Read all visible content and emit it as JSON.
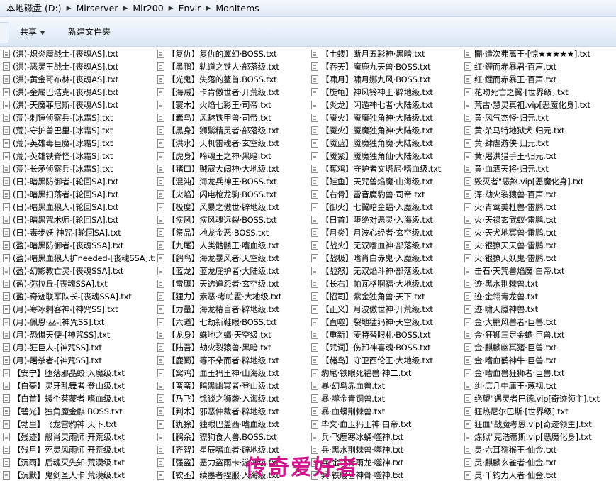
{
  "address": {
    "segments": [
      "本地磁盘 (D:)",
      "Mirserver",
      "Mir200",
      "Envir",
      "MonItems"
    ]
  },
  "toolbar": {
    "share_label": "共享",
    "new_folder_label": "新建文件夹"
  },
  "columns": [
    [
      "(洪)-炽炎魔战士-[丧魂AS].txt",
      "(洪)-恶灵王战士-[丧魂AS].txt",
      "(洪)-黄金哥布林-[丧魂AS].txt",
      "(洪)-金属巴浩克-[丧魂AS].txt",
      "(洪)-天魔菲尼斯-[丧魂AS].txt",
      "(荒)-刺锤侦察兵-[冰霜S].txt",
      "(荒)-守护兽巴里-[冰霜S].txt",
      "(荒)-英雄毒巨魔-[冰霜S].txt",
      "(荒)-英雄铁脊怪-[冰霜S].txt",
      "(荒)-长矛侦察兵-[冰霜S].txt",
      "(日)-暗黑防御者-[轮回SA].txt",
      "(日)-暗黑扫荡者-[轮回SA].txt",
      "(日)-暗黑血狼人-[轮回SA].txt",
      "(日)-暗黑咒术师-[轮回SA].txt",
      "(日)-毒步妖·神咒-[轮回SA].txt",
      "(盈)-暗黑防御者-[丧魂SSA].txt",
      "(盈)-暗黑血狼人扩needed-[丧魂SSA].txt",
      "(盈)-幻影教亡灵-[丧魂SSA].txt",
      "(盈)-弥拉丘-[丧魂SSA].txt",
      "(盈)-奇迹联军队长-[丧魂SSA].txt",
      "(月)-寒冰刺客神-[神咒SS].txt",
      "(月)-佩恩·巫-[神咒SS].txt",
      "(月)-恐惧天使-[神咒SS].txt",
      "(月)-狂巨人-[神咒SS].txt",
      "(月)-屠杀者-[神咒SS].txt",
      "【安宁】堕落邪晶蛟·入魔级.txt",
      "【白豪】灵牙乱舞者·登山级.txt",
      "【白首】矮个莱蒙者·嗜血级.txt",
      "【碧光】独角魔金麒·BOSS.txt",
      "【勃皇】飞龙雷豹神·天下.txt",
      "【残迹】般肖灵雨师·开荒级.txt",
      "【残月】死灵风雨师·开荒级.txt",
      "【沉雨】后魂灭先知·荒漠级.txt",
      "【沉默】鬼剑圣人卡·荒漠级.txt"
    ],
    [
      "【复仇】复仇的翼幻·BOSS.txt",
      "【黑鹏】轨道之铁人·部落级.txt",
      "【光鬼】失落的鳌首.BOSS.txt",
      "【海贼】卡肯傲世者·开荒级.txt",
      "【寰木】火焰七彩王·司帝.txt",
      "【蠹鸟】风魅铁甲兽·司帝.txt",
      "【黑身】狮鬃精灵者·部落级.txt",
      "【洪水】天机雷魂者·玄空级.txt",
      "【虎身】啼魂王之神·黑暗.txt",
      "【猪口】贼寇大阔神·大地级.txt",
      "【混沌】海龙兵神王·BOSS.txt",
      "【火焰】闪电枪龙驹·BOSS.txt",
      "【极度】风暴之傲世·辟地级.txt",
      "【疾风】疾风魂远裂·BOSS.txt",
      "【祭品】地龙金恶·BOSS.txt",
      "【九尾】人类骷髅王·嗜血级.txt",
      "【鹞鸟】海龙暴风者·天空级.txt",
      "【蓝龙】蓝龙庇护者·大陆级.txt",
      "【雷鹰】天选道怨者·玄空级.txt",
      "【狸力】素恶·考帕霍·大地级.txt",
      "【力量】海龙椿盲者·辟地级.txt",
      "【六道】七劫新鞋眼·BOSS.txt",
      "【龙身】蛛地之蝎·天空级.txt",
      "【陆吾】劫火裂猿兽·黑暗.txt",
      "【鹿蜀】等不朵而者·辟地级.txt",
      "【窝鸡】血玉犸王神·山海级.txt",
      "【蛮蛮】暗黑幽冥者·登山级.txt",
      "【乃飞】馀谈之狮袭·入海级.txt",
      "【判木】邪恶仲裁者·辟地级.txt",
      "【犰狳】独眼巴盖西·嗜血级.txt",
      "【鹞余】獠狗食人兽.BOSS.txt",
      "【齐智】星辰嗜血者·辟地级.txt",
      "【强盗】恶力盗雨卡·游神级.txt",
      "【钦丕】续墨者捏服·入海级.txt"
    ],
    [
      "【土蝼】断月五彩神·黑暗.txt",
      "【吞天】魔鹿九天兽·BOSS.txt",
      "【啸月】啸月娜九风·BOSS.txt",
      "【旋龟】神风铃神王·辟地级.txt",
      "【炎龙】闪遁神七者·大陆级.txt",
      "【魇火】魇魔独角神·大陆级.txt",
      "【魇火】魇魔独角神·大陆级.txt",
      "【魇蓝】魇魔独角魔·大陆级.txt",
      "【魇紫】魇魔独角仙·大陆级.txt",
      "【奪鸡】守护者文塔尼·嗜血级.txt",
      "【鲑鱼】天咒兽焰魔·山海级.txt",
      "【右骨】雷音魔豹兽·司帝.txt",
      "【御火】七翼暗金蝠·入魔级.txt",
      "【日首】堕绝对恶灵·入海级.txt",
      "【月炎】月波心经者·玄空级.txt",
      "【战火】无双嗜血神·部落级.txt",
      "【战极】嗜肖白赤鬼·入魔级.txt",
      "【战怒】无双焰斗神·部落级.txt",
      "【长右】帕瓦格啊福·大地级.txt",
      "【招司】紫金独角兽·天下.txt",
      "【正义】月波傲世神·开荒级.txt",
      "【直噬】裂地猛犸神·天空级.txt",
      "【重新】麦特替眼札·BOSS.txt",
      "【咒词】伤卸神喜魂·BOSS.txt",
      "【赭鸟】守卫西伦王·大地级.txt",
      "豹尾·铁眼死福兽·神二.txt",
      "暴·幻鸟赤血兽.txt",
      "暴·噬金青铜兽.txt",
      "暴·血蟒荆棘兽.txt",
      "毕文·血玉犸王神·白帝.txt",
      "兵·飞鹿寒冰蛹·噬神.txt",
      "兵·黑水荆棘兽·噬神.txt",
      "兵·金翎青雨龙·噬神.txt",
      "兵·铁暖啬神骨·噬神.txt"
    ],
    [
      "闇·造次弗离王·[惊★★★★★].txt",
      "红·鲤而赤暴君·百声.txt",
      "红·鲤而赤暴王·百声.txt",
      "花吻死亡之翼·[世界级].txt",
      "荒古·慧灵真祖.vip[恶魔化身].txt",
      "黄·风气杰怪·归元.txt",
      "黄·杀马特地狱犬·归元.txt",
      "黄·肆虐游侠·归元.txt",
      "黄·屠洪猎手王·归元.txt",
      "黄·血洒天将·归元.txt",
      "毁灭者\"恶煞.vip[恶魔化身].txt",
      "浑·劫火裂猿兽·百声.txt",
      "火·青莺美杜兽·雷鹏.txt",
      "火·天禄玄武蚁·雷鹏.txt",
      "火·天犬地冥兽·雷鹏.txt",
      "火·银獠天天兽·雷鹏.txt",
      "火·银獠天妖鬼·雷鹏.txt",
      "击石·天咒兽焰魔·白帝.txt",
      "迹·黑水荆棘兽.txt",
      "迹·金翎青龙兽.txt",
      "迹·啸天魇神兽.txt",
      "金·大鹏风兽者·巨兽.txt",
      "金·狂狮三足金蟾·巨兽.txt",
      "金·麒麟幽冥猪·巨兽.txt",
      "金·嗜血鹤神牛·巨兽.txt",
      "金·嗜血兽狂狮者·巨兽.txt",
      "纠·庶几中庸王·蔑视.txt",
      "绝望\"遇灵者巴德.vip[奇迹领主].txt",
      "狂热尼尔巴斯·[世界级].txt",
      "狂血\"战魔考恩.vip[奇迹领主].txt",
      "炼狱\"克浩蒂斯.vip[恶魔化身].txt",
      "灵·六耳猕猴王·仙金.txt",
      "灵·麒麟玄雀者·仙金.txt",
      "灵·千钧力人者·仙金.txt"
    ]
  ],
  "watermark": "传奇爱好者"
}
